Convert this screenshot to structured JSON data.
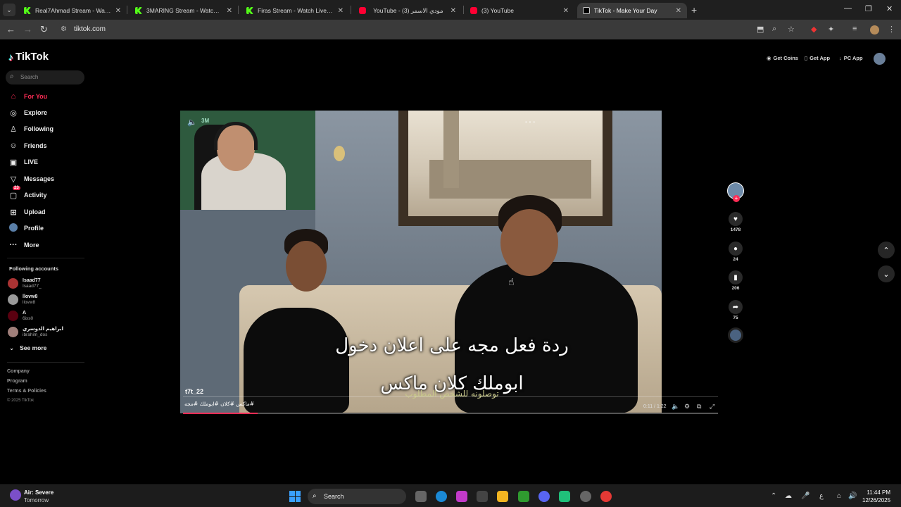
{
  "browser": {
    "tabs": [
      {
        "title": "Real7Ahmad Stream - Watch Li",
        "favicon": "kick-icon",
        "active": false
      },
      {
        "title": "3MARING Stream - Watch Live",
        "favicon": "kick-icon",
        "active": false
      },
      {
        "title": "Firas Stream - Watch Live on K",
        "favicon": "kick-icon",
        "active": false
      },
      {
        "title": "YouTube - (3) مودي الاسمر",
        "favicon": "youtube-icon",
        "active": false
      },
      {
        "title": "(3) YouTube",
        "favicon": "youtube-icon",
        "active": false
      },
      {
        "title": "TikTok - Make Your Day",
        "favicon": "tiktok-icon",
        "active": true
      }
    ],
    "close_glyph": "✕",
    "new_tab_glyph": "+",
    "url": "tiktok.com"
  },
  "tiktok": {
    "logo_text": "TikTok",
    "search_placeholder": "Search",
    "nav": [
      {
        "label": "For You",
        "icon": "home-icon",
        "active": true
      },
      {
        "label": "Explore",
        "icon": "compass-icon"
      },
      {
        "label": "Following",
        "icon": "following-icon"
      },
      {
        "label": "Friends",
        "icon": "friends-icon"
      },
      {
        "label": "LIVE",
        "icon": "live-icon"
      },
      {
        "label": "Messages",
        "icon": "messages-icon"
      },
      {
        "label": "Activity",
        "icon": "activity-icon",
        "badge": "23"
      },
      {
        "label": "Upload",
        "icon": "upload-icon"
      },
      {
        "label": "Profile",
        "icon": "profile-icon"
      },
      {
        "label": "More",
        "icon": "more-icon"
      }
    ],
    "following_heading": "Following accounts",
    "following": [
      {
        "name": "Isaad77",
        "handle": "Isaad77_"
      },
      {
        "name": "llovw8",
        "handle": "llovw8"
      },
      {
        "name": "A",
        "handle": "6ixs0"
      },
      {
        "name": "ابراهيم الدوسري",
        "handle": "ibrahim_dos"
      }
    ],
    "see_more": "See more",
    "footer": [
      "Company",
      "Program",
      "Terms & Policies"
    ],
    "copyright": "© 2025 TikTok",
    "header_buttons": [
      "Get Coins",
      "Get App",
      "PC App"
    ],
    "video": {
      "subtitle_line1": "ردة فعل مجه على اعلان دخول",
      "subtitle_line2": "ابوملك كلان ماكس",
      "subtitle_small": "توصلونه للشخص المطلوب",
      "cam_tag": "3M",
      "author": "t7t_22",
      "tags": "#ماكس #كلان #ابوملك #مجه",
      "time": "0:11 / 1:22",
      "progress_fraction": 0.14
    },
    "actions": {
      "likes": "1478",
      "comments": "24",
      "saves": "206",
      "shares": "75"
    }
  },
  "taskbar": {
    "weather_title": "Air: Severe",
    "weather_sub": "Tomorrow",
    "search_placeholder": "Search",
    "time": "11:44 PM",
    "date": "12/26/2025"
  }
}
